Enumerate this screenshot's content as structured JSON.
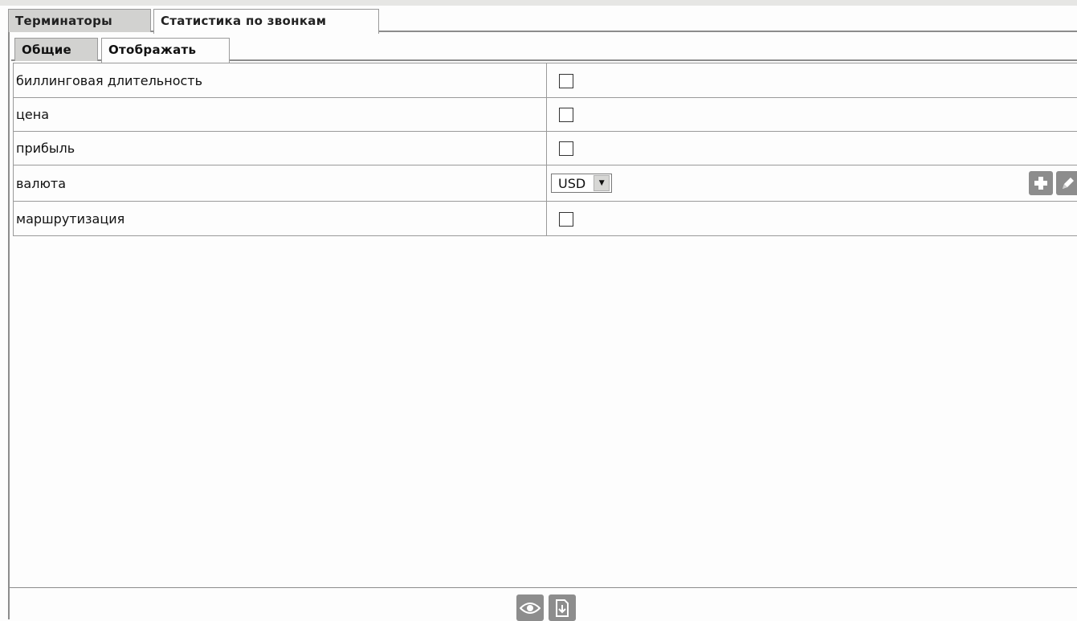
{
  "tabs": [
    {
      "label": "Терминаторы",
      "active": false
    },
    {
      "label": "Статистика по звонкам",
      "active": true
    }
  ],
  "subtabs": [
    {
      "label": "Общие",
      "active": false
    },
    {
      "label": "Отображать",
      "active": true
    }
  ],
  "rows": [
    {
      "label": "биллинговая длительность",
      "control": "checkbox",
      "checked": false
    },
    {
      "label": "цена",
      "control": "checkbox",
      "checked": false
    },
    {
      "label": "прибыль",
      "control": "checkbox",
      "checked": false
    },
    {
      "label": "валюта",
      "control": "select",
      "value": "USD",
      "actions": [
        "plus-icon",
        "edit-icon"
      ]
    },
    {
      "label": "маршрутизация",
      "control": "checkbox",
      "checked": false
    }
  ],
  "bottom_actions": [
    "eye-icon",
    "download-icon"
  ],
  "colors": {
    "icon_button": "#8d8d8d",
    "tab_inactive": "#d2d2d0",
    "border": "#8c8c8c"
  }
}
